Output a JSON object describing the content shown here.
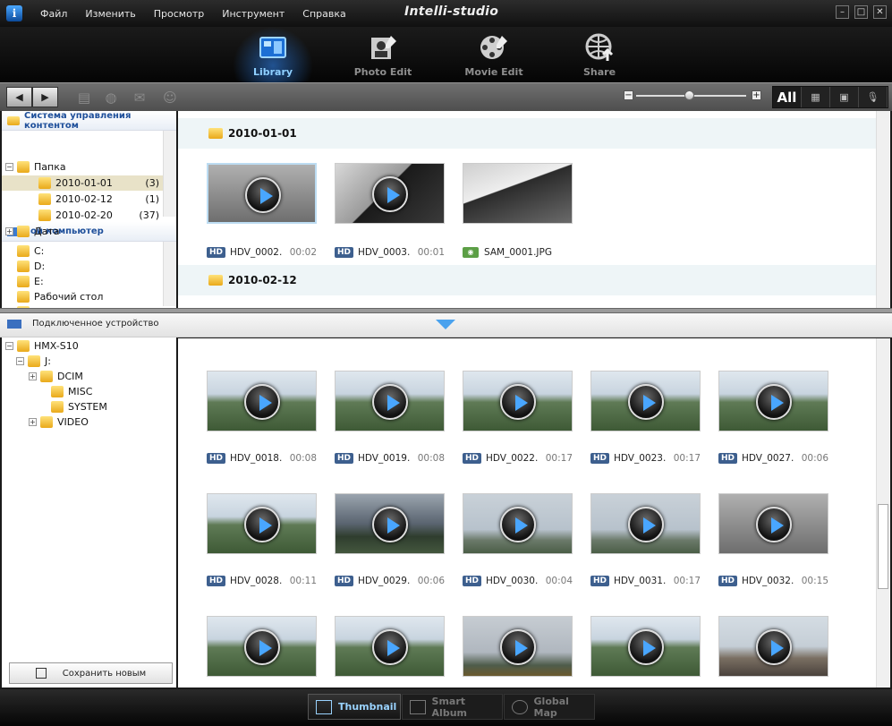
{
  "window": {
    "brand": "Intelli-studio"
  },
  "menu": [
    "Файл",
    "Изменить",
    "Просмотр",
    "Инструмент",
    "Справка"
  ],
  "window_controls": {
    "minimize": "–",
    "maximize": "□",
    "close": "✕"
  },
  "main_nav": [
    {
      "label": "Library",
      "icon": "library-icon",
      "active": true
    },
    {
      "label": "Photo Edit",
      "icon": "photo-edit-icon"
    },
    {
      "label": "Movie Edit",
      "icon": "movie-edit-icon"
    },
    {
      "label": "Share",
      "icon": "share-icon"
    }
  ],
  "toolbar": {
    "back": "◀",
    "forward": "▶",
    "zoom_minus": "−",
    "zoom_plus": "+",
    "zoom_level": 0.48,
    "filter_all": "All"
  },
  "left_panel": {
    "cms_title": "Система управления контентом",
    "cms_tree": [
      {
        "label": "Папка",
        "exp": "−"
      },
      {
        "label": "2010-01-01",
        "count": "(3)",
        "selected": true
      },
      {
        "label": "2010-02-12",
        "count": "(1)"
      },
      {
        "label": "2010-02-20",
        "count": "(37)"
      },
      {
        "label": "Дата",
        "exp": "+"
      }
    ],
    "computer_title": "Мой компьютер",
    "computer_tree": [
      {
        "label": "C:"
      },
      {
        "label": "D:"
      },
      {
        "label": "E:"
      },
      {
        "label": "Рабочий стол"
      },
      {
        "label": "М..."
      }
    ],
    "device_title": "Подключенное устройство",
    "device_tree": [
      {
        "label": "HMX-S10",
        "exp": "−"
      },
      {
        "label": "J:",
        "exp": "−"
      },
      {
        "label": "DCIM",
        "exp": "+"
      },
      {
        "label": "MISC"
      },
      {
        "label": "SYSTEM"
      },
      {
        "label": "VIDEO",
        "exp": "+"
      }
    ],
    "save_button": "Сохранить новым"
  },
  "groups": [
    {
      "date": "2010-01-01",
      "items": [
        {
          "name": "HDV_0002.",
          "duration": "00:02",
          "type": "HD",
          "scene": "gray"
        },
        {
          "name": "HDV_0003.",
          "duration": "00:01",
          "type": "HD",
          "scene": "monitor"
        },
        {
          "name": "SAM_0001.JPG",
          "duration": "",
          "type": "photo",
          "scene": "car"
        }
      ]
    },
    {
      "date": "2010-02-12",
      "items": []
    }
  ],
  "device_items": [
    {
      "name": "HDV_0018.",
      "duration": "00:08",
      "scene": "town"
    },
    {
      "name": "HDV_0019.",
      "duration": "00:08",
      "scene": "town"
    },
    {
      "name": "HDV_0022.",
      "duration": "00:17",
      "scene": "town"
    },
    {
      "name": "HDV_0023.",
      "duration": "00:17",
      "scene": "town"
    },
    {
      "name": "HDV_0027.",
      "duration": "00:06",
      "scene": "town"
    },
    {
      "name": "HDV_0028.",
      "duration": "00:11",
      "scene": "town"
    },
    {
      "name": "HDV_0029.",
      "duration": "00:06",
      "scene": "dark"
    },
    {
      "name": "HDV_0030.",
      "duration": "00:04",
      "scene": "chimney"
    },
    {
      "name": "HDV_0031.",
      "duration": "00:17",
      "scene": "chimney"
    },
    {
      "name": "HDV_0032.",
      "duration": "00:15",
      "scene": "gray"
    },
    {
      "name": "",
      "duration": "",
      "scene": "town"
    },
    {
      "name": "",
      "duration": "",
      "scene": "town"
    },
    {
      "name": "",
      "duration": "",
      "scene": "dome"
    },
    {
      "name": "",
      "duration": "",
      "scene": "town"
    },
    {
      "name": "",
      "duration": "",
      "scene": "roof"
    }
  ],
  "bottom_tabs": [
    {
      "label": "Thumbnail",
      "active": true
    },
    {
      "label": "Smart Album"
    },
    {
      "label": "Global Map"
    }
  ]
}
